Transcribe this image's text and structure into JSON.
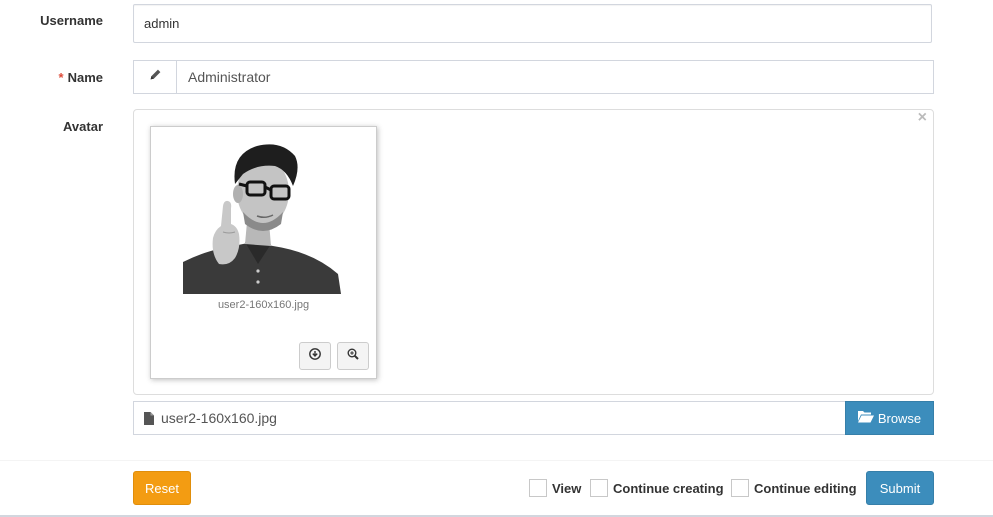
{
  "form": {
    "username_label": "Username",
    "username_value": "admin",
    "name_required_mark": "*",
    "name_label": "Name",
    "name_value": "Administrator",
    "avatar_label": "Avatar",
    "preview_close": "×",
    "thumbnail_caption": "user2-160x160.jpg",
    "file_caption": "user2-160x160.jpg",
    "browse_label": "Browse"
  },
  "footer": {
    "reset_label": "Reset",
    "view_label": "View",
    "continue_creating_label": "Continue creating",
    "continue_editing_label": "Continue editing",
    "submit_label": "Submit"
  },
  "icons": {
    "name_addon": "pencil-icon",
    "download": "download-icon",
    "zoom": "zoom-in-icon",
    "file": "file-icon",
    "browse": "folder-open-icon"
  },
  "colors": {
    "primary": "#3c8dbc",
    "warning": "#f39c12",
    "required": "#dd4b39"
  }
}
